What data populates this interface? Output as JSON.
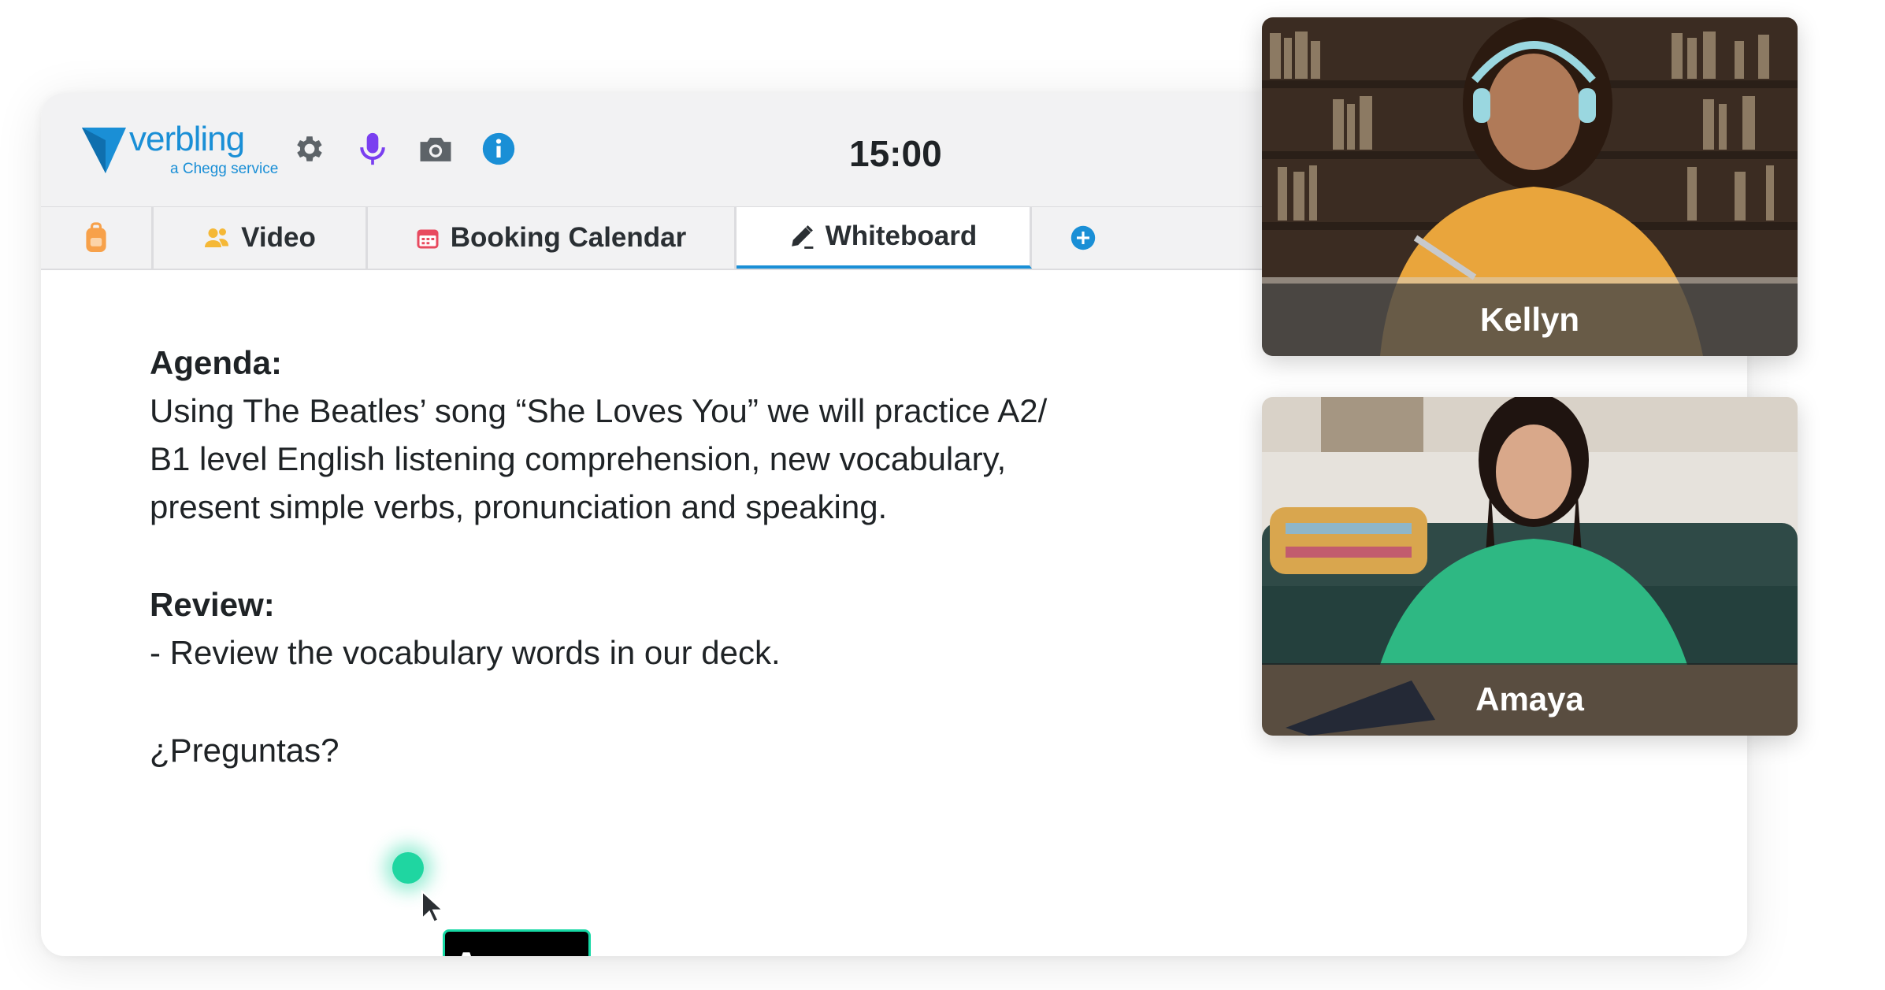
{
  "brand": {
    "name": "verbling",
    "tagline": "a Chegg service",
    "color": "#1a8fd6"
  },
  "toolbar": {
    "icons": [
      "gear-icon",
      "microphone-icon",
      "camera-icon",
      "info-icon"
    ],
    "timer": "15:00"
  },
  "tabs": [
    {
      "label": "",
      "icon": "backpack-icon"
    },
    {
      "label": "Video",
      "icon": "people-icon"
    },
    {
      "label": "Booking Calendar",
      "icon": "calendar-icon"
    },
    {
      "label": "Whiteboard",
      "icon": "pencil-icon",
      "active": true
    },
    {
      "label": "",
      "icon": "plus-circle-icon"
    }
  ],
  "whiteboard": {
    "agenda_heading": "Agenda:",
    "agenda_line1": "Using The Beatles’ song “She Loves You” we will practice A2/",
    "agenda_line2": "B1 level English listening comprehension, new vocabulary,",
    "agenda_line3": "present simple verbs, pronunciation and speaking.",
    "review_heading": "Review:",
    "review_line": "- Review the vocabulary words in our deck.",
    "question": "¿Preguntas?"
  },
  "cursor": {
    "user": "Amaya",
    "color": "#16d8a4"
  },
  "participants": [
    {
      "name": "Kellyn"
    },
    {
      "name": "Amaya"
    }
  ]
}
